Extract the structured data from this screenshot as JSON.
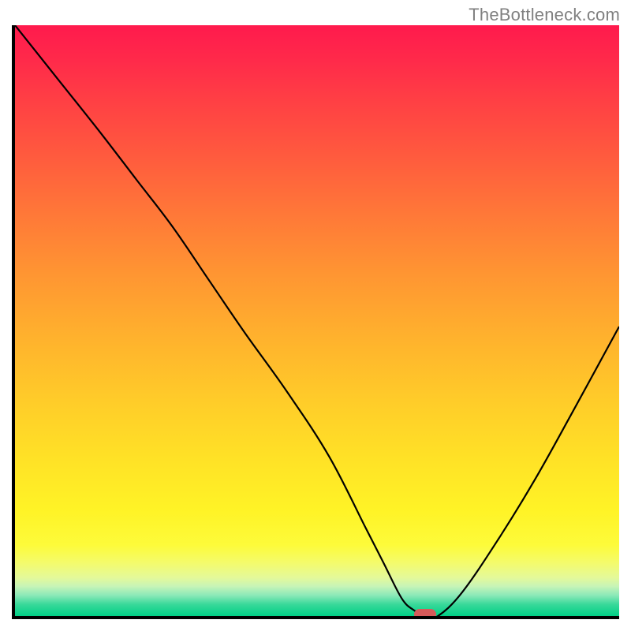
{
  "watermark": "TheBottleneck.com",
  "chart_data": {
    "type": "line",
    "title": "",
    "xlabel": "",
    "ylabel": "",
    "xlim": [
      0,
      100
    ],
    "ylim": [
      0,
      100
    ],
    "grid": false,
    "series": [
      {
        "name": "curve",
        "x": [
          0,
          7,
          14,
          20,
          26,
          32,
          38,
          45,
          52,
          58,
          61,
          64,
          66,
          68,
          70,
          74,
          80,
          86,
          92,
          100
        ],
        "values": [
          100,
          91,
          82,
          74,
          66,
          57,
          48,
          38,
          27,
          15,
          9,
          3,
          1,
          0,
          0,
          4,
          13,
          23,
          34,
          49
        ]
      }
    ],
    "marker": {
      "x_pct": 67.5,
      "y_pct": 0.4
    }
  }
}
